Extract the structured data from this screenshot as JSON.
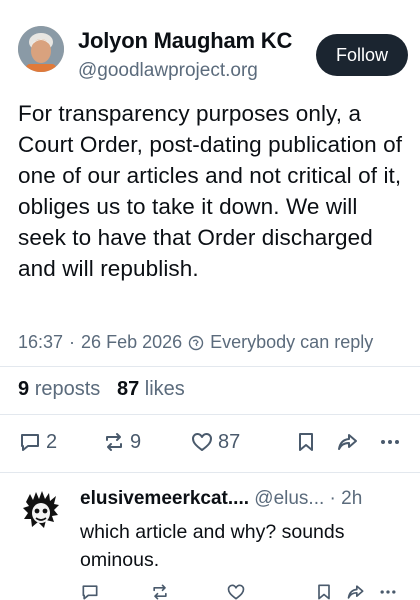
{
  "post": {
    "author_name": "Jolyon Maugham KC",
    "author_handle": "@goodlawproject.org",
    "follow_label": "Follow",
    "text": "For transparency purposes only, a Court Order, post-dating publication of one of our articles and not critical of it, obliges us to take it down. We will seek to have that Order discharged and will republish.",
    "time": "16:37",
    "separator": "·",
    "date": "26 Feb 2026",
    "reply_setting": "Everybody can reply",
    "reposts_count": "9",
    "reposts_label": "reposts",
    "likes_count": "87",
    "likes_label": "likes",
    "actions": {
      "reply_count": "2",
      "repost_count": "9",
      "like_count": "87"
    }
  },
  "reply": {
    "author_name": "elusivemeerkcat....",
    "author_handle": "@elus...",
    "separator": "·",
    "age": "2h",
    "text": "which article and why? sounds ominous."
  },
  "colors": {
    "follow_bg": "#1b2530",
    "secondary_text": "#5b6b7c",
    "icon": "#4a5a6c",
    "divider": "#e3e8ee"
  }
}
